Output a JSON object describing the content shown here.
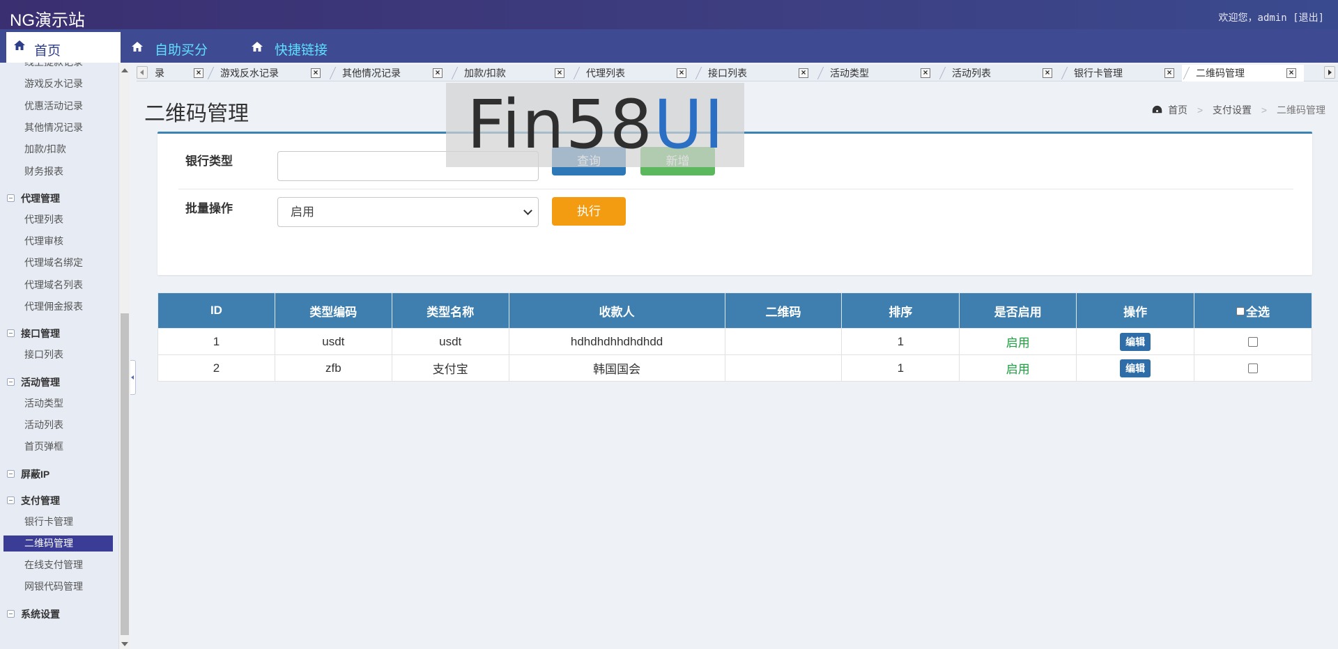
{
  "header": {
    "brand": "NG演示站",
    "welcome": "欢迎您，admin",
    "logout": "[退出]"
  },
  "nav": {
    "home": "首页",
    "items": [
      "自助买分",
      "快捷链接"
    ]
  },
  "sidebar": {
    "items": [
      {
        "type": "item",
        "label": "线上提款记录"
      },
      {
        "type": "item",
        "label": "游戏反水记录"
      },
      {
        "type": "item",
        "label": "优惠活动记录"
      },
      {
        "type": "item",
        "label": "其他情况记录"
      },
      {
        "type": "item",
        "label": "加款/扣款"
      },
      {
        "type": "item",
        "label": "财务报表"
      },
      {
        "type": "group",
        "label": "代理管理"
      },
      {
        "type": "item",
        "label": "代理列表"
      },
      {
        "type": "item",
        "label": "代理审核"
      },
      {
        "type": "item",
        "label": "代理域名绑定"
      },
      {
        "type": "item",
        "label": "代理域名列表"
      },
      {
        "type": "item",
        "label": "代理佣金报表"
      },
      {
        "type": "group",
        "label": "接口管理"
      },
      {
        "type": "item",
        "label": "接口列表"
      },
      {
        "type": "group",
        "label": "活动管理"
      },
      {
        "type": "item",
        "label": "活动类型"
      },
      {
        "type": "item",
        "label": "活动列表"
      },
      {
        "type": "item",
        "label": "首页弹框"
      },
      {
        "type": "group",
        "label": "屏蔽IP"
      },
      {
        "type": "group",
        "label": "支付管理"
      },
      {
        "type": "item",
        "label": "银行卡管理"
      },
      {
        "type": "item",
        "label": "二维码管理",
        "active": true
      },
      {
        "type": "item",
        "label": "在线支付管理"
      },
      {
        "type": "item",
        "label": "网银代码管理"
      },
      {
        "type": "group",
        "label": "系统设置"
      }
    ]
  },
  "tabs": [
    {
      "label": "录"
    },
    {
      "label": "游戏反水记录"
    },
    {
      "label": "其他情况记录"
    },
    {
      "label": "加款/扣款"
    },
    {
      "label": "代理列表"
    },
    {
      "label": "接口列表"
    },
    {
      "label": "活动类型"
    },
    {
      "label": "活动列表"
    },
    {
      "label": "银行卡管理"
    },
    {
      "label": "二维码管理",
      "active": true
    }
  ],
  "tab_close": "×",
  "page": {
    "title": "二维码管理",
    "breadcrumb": {
      "home": "首页",
      "parent": "支付设置",
      "current": "二维码管理",
      "sep": ">"
    }
  },
  "filter": {
    "bank_type_label": "银行类型",
    "bank_type_value": "",
    "query_button": "查询",
    "add_button": "新增",
    "batch_label": "批量操作",
    "batch_selected": "启用",
    "exec_button": "执行"
  },
  "watermark": {
    "text_a": "Fin58",
    "text_b": "UI"
  },
  "table": {
    "headers": [
      "ID",
      "类型编码",
      "类型名称",
      "收款人",
      "二维码",
      "排序",
      "是否启用",
      "操作",
      "全选"
    ],
    "rows": [
      {
        "id": "1",
        "code": "usdt",
        "name": "usdt",
        "payee": "hdhdhdhhdhdhdd",
        "qrcode": "",
        "sort": "1",
        "enabled": "启用",
        "action": "编辑"
      },
      {
        "id": "2",
        "code": "zfb",
        "name": "支付宝",
        "payee": "韩国国会",
        "qrcode": "",
        "sort": "1",
        "enabled": "启用",
        "action": "编辑"
      }
    ]
  },
  "colors": {
    "header_bg": "#3a2f70",
    "nav_bg": "#3e4a92",
    "nav_link": "#5fe0ff",
    "sidebar_active": "#3a3c95",
    "table_header": "#3e7fb0",
    "btn_query": "#2f78b8",
    "btn_add": "#5cb85c",
    "btn_exec": "#f39c12",
    "enabled_text": "#1e9e40"
  },
  "icons": {
    "nav": "home-icon",
    "breadcrumb": "dashboard-icon",
    "sidebar_group": "collapse-toggle-icon",
    "tab_close": "close-icon"
  }
}
